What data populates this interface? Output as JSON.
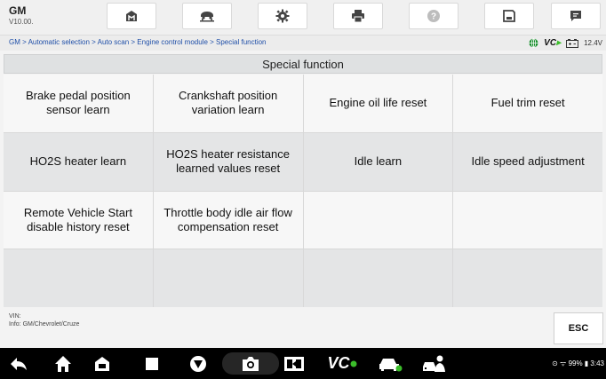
{
  "app": {
    "name": "GM",
    "version": "V10.00."
  },
  "toolbar": {
    "icons": [
      "home-icon",
      "vehicle-lift-icon",
      "settings-icon",
      "printer-icon",
      "help-icon",
      "save-icon",
      "message-icon"
    ]
  },
  "breadcrumb": "GM > Automatic selection > Auto scan > Engine control module > Special function",
  "status": {
    "vcb_prefix": "VC",
    "voltage": "12.4V"
  },
  "page": {
    "title": "Special function"
  },
  "functions": [
    "Brake pedal position sensor learn",
    "Crankshaft position variation learn",
    "Engine oil life reset",
    "Fuel trim reset",
    "HO2S heater learn",
    "HO2S heater resistance learned values reset",
    "Idle learn",
    "Idle speed adjustment",
    "Remote Vehicle Start disable history reset",
    "Throttle body idle air flow compensation reset",
    "",
    "",
    "",
    "",
    "",
    ""
  ],
  "footer": {
    "vin": "VIN:",
    "info": "Info: GM/Chevrolet/Cruze",
    "esc_label": "ESC"
  },
  "android_nav": {
    "icons": [
      "back-icon",
      "home-icon",
      "house-icon",
      "recents-icon",
      "browser-icon",
      "camera-icon",
      "screenshot-icon",
      "vci-icon",
      "car-icon",
      "car-person-icon"
    ],
    "vci_label": "VC",
    "status_text": "99% ▮ 3:43"
  },
  "colors": {
    "accent_link": "#1f4fa8",
    "vcb_green": "#3bbd2a"
  }
}
